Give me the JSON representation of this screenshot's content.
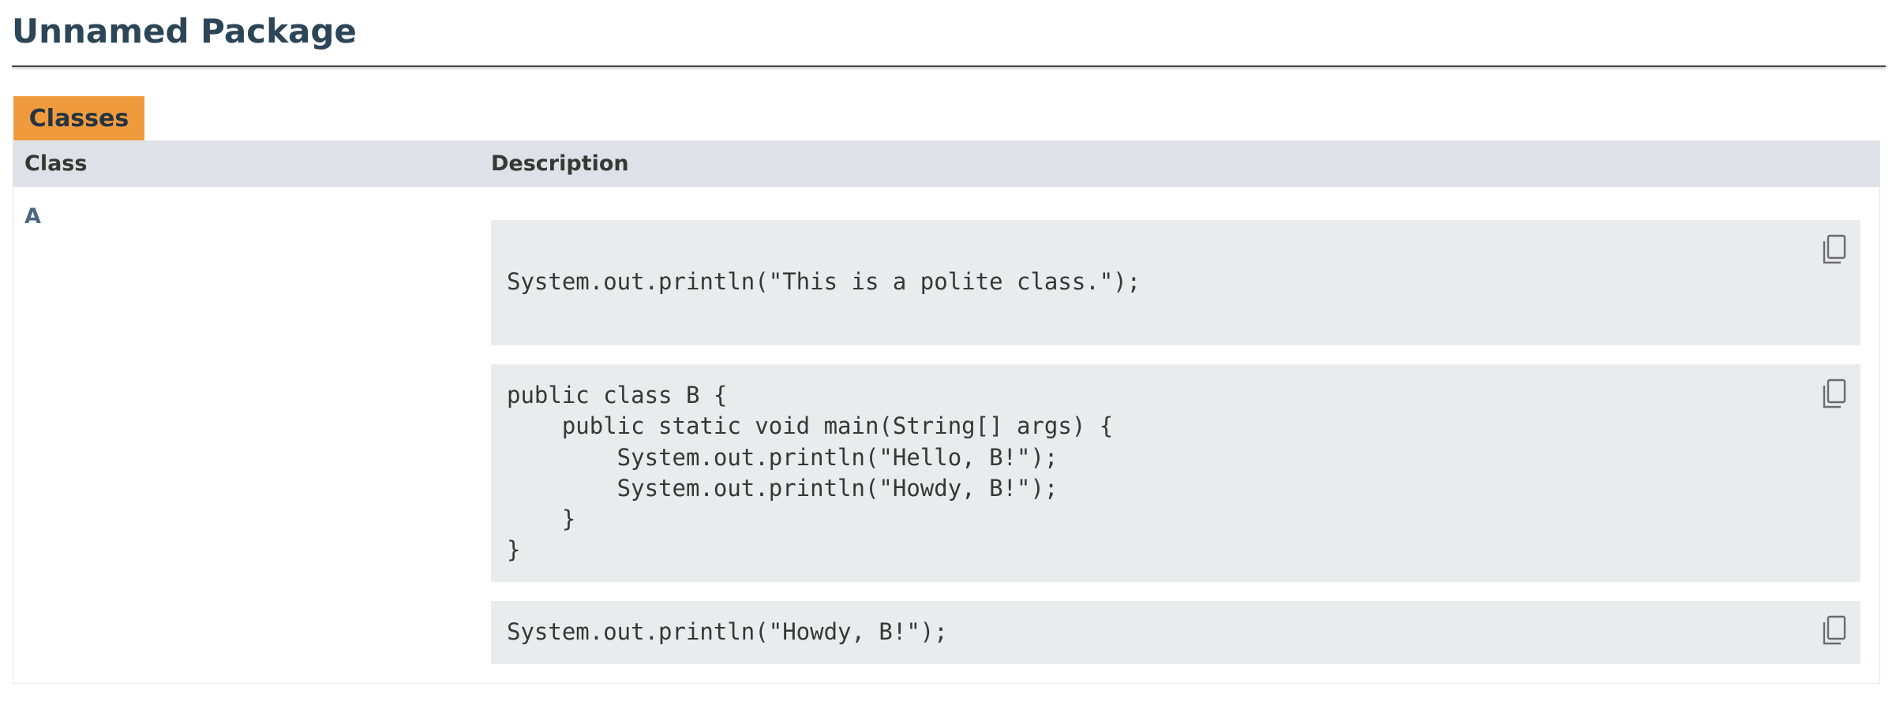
{
  "page": {
    "title": "Unnamed Package"
  },
  "tabs": [
    {
      "label": "Classes"
    }
  ],
  "table": {
    "headers": [
      "Class",
      "Description"
    ],
    "rows": [
      {
        "class_name": "A",
        "code_blocks": [
          "\nSystem.out.println(\"This is a polite class.\");\n",
          "public class B {\n    public static void main(String[] args) {\n        System.out.println(\"Hello, B!\");\n        System.out.println(\"Howdy, B!\");\n    }\n}",
          "System.out.println(\"Howdy, B!\");"
        ]
      }
    ]
  },
  "icons": {
    "copy": "copy-icon"
  },
  "colors": {
    "title": "#2c4557",
    "tab_bg": "#f09a3e",
    "header_bg": "#dee1e7",
    "code_bg": "#eaebed",
    "link": "#4a6782"
  }
}
